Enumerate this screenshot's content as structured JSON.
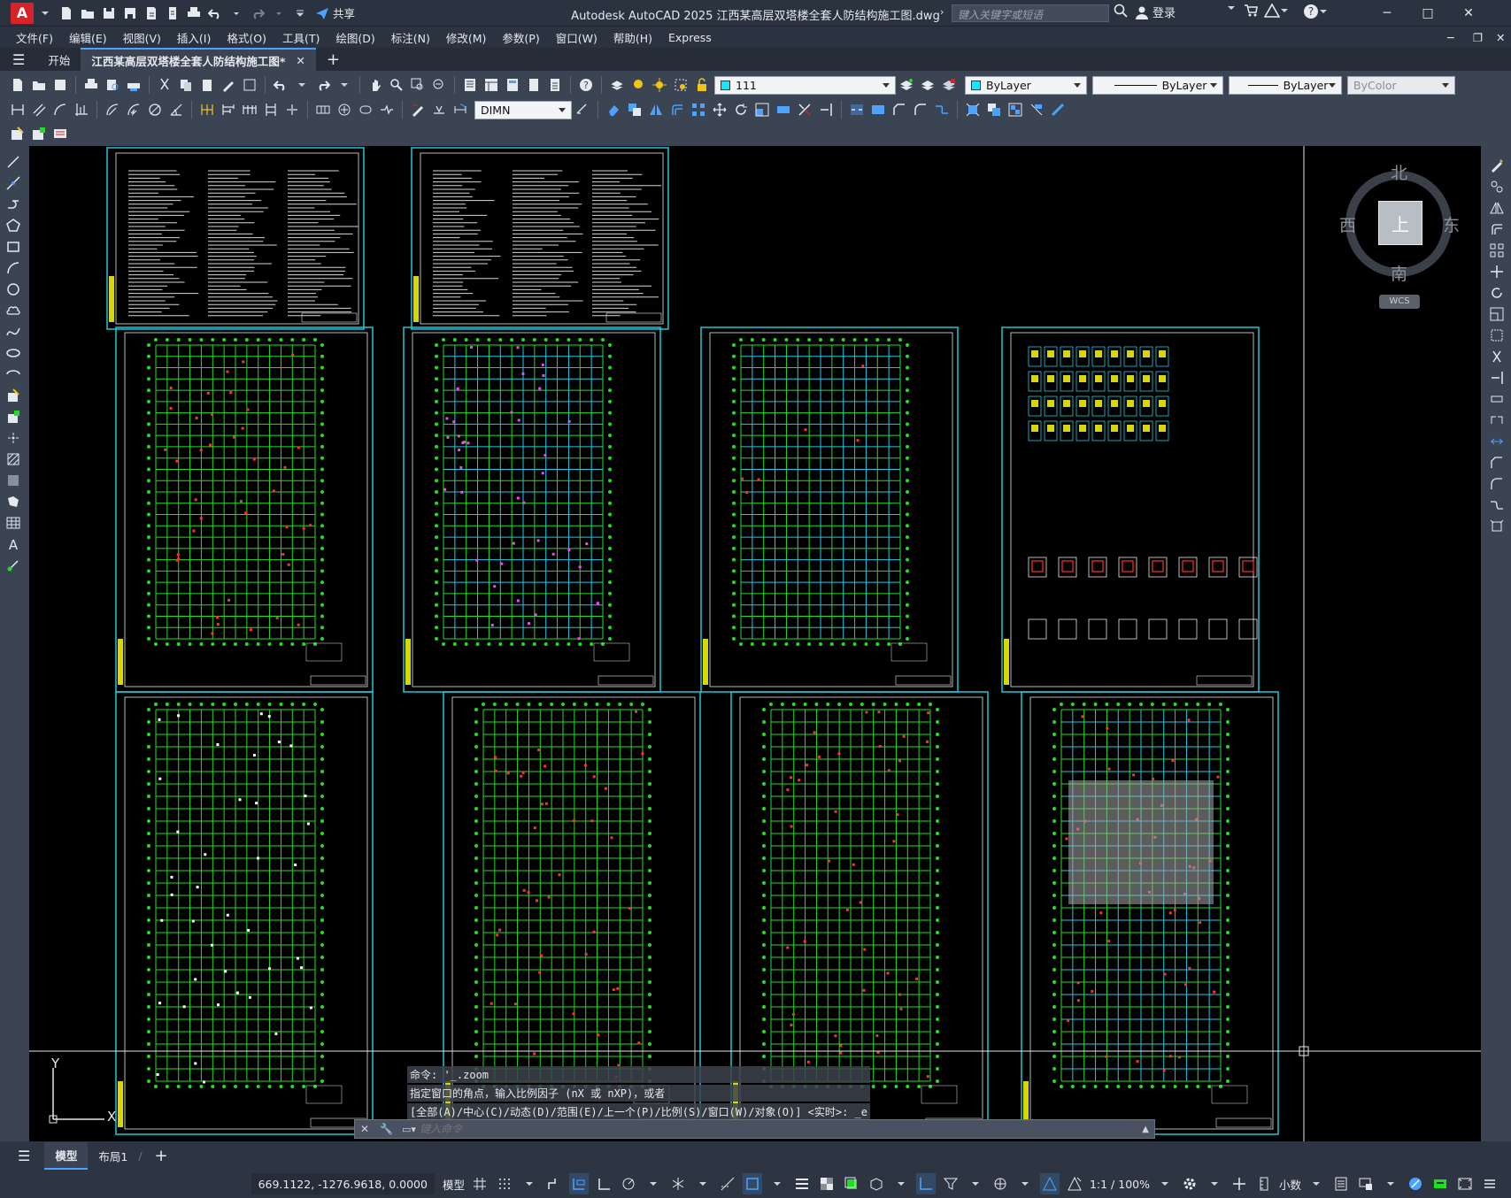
{
  "titlebar": {
    "logo": "A",
    "share_label": "共享",
    "title": "Autodesk AutoCAD 2025    江西某高层双塔楼全套人防结构施工图.dwg",
    "search_placeholder": "键入关键字或短语",
    "login_label": "登录"
  },
  "menu": [
    "文件(F)",
    "编辑(E)",
    "视图(V)",
    "插入(I)",
    "格式(O)",
    "工具(T)",
    "绘图(D)",
    "标注(N)",
    "修改(M)",
    "参数(P)",
    "窗口(W)",
    "帮助(H)",
    "Express"
  ],
  "tabs": {
    "start": "开始",
    "file": "江西某高层双塔楼全套人防结构施工图*"
  },
  "toolbar": {
    "layer_name": "111",
    "color": "ByLayer",
    "linetype": "ByLayer",
    "lineweight": "ByLayer",
    "plotstyle": "ByColor",
    "dimstyle": "DIMN"
  },
  "viewcube": {
    "north": "北",
    "south": "南",
    "east": "东",
    "west": "西",
    "top": "上",
    "wcs": "WCS"
  },
  "ucs": {
    "x": "X",
    "y": "Y"
  },
  "command": {
    "history": [
      "命令: '_.zoom",
      "指定窗口的角点，输入比例因子 (nX 或 nXP)，或者",
      "[全部(A)/中心(C)/动态(D)/范围(E)/上一个(P)/比例(S)/窗口(W)/对象(O)] <实时>: _e"
    ],
    "placeholder": "键入命令"
  },
  "layouts": {
    "model": "模型",
    "layout1": "布局1"
  },
  "status": {
    "coords": "669.1122, -1276.9618, 0.0000",
    "model": "模型",
    "scale": "1:1 / 100%",
    "units": "小数"
  },
  "colors": {
    "canvas": "#000000",
    "sheet_border": "#1fc8d8",
    "grid_green": "#22dd22",
    "beam_cyan": "#22c8e0",
    "accent": "#4da1ff"
  }
}
